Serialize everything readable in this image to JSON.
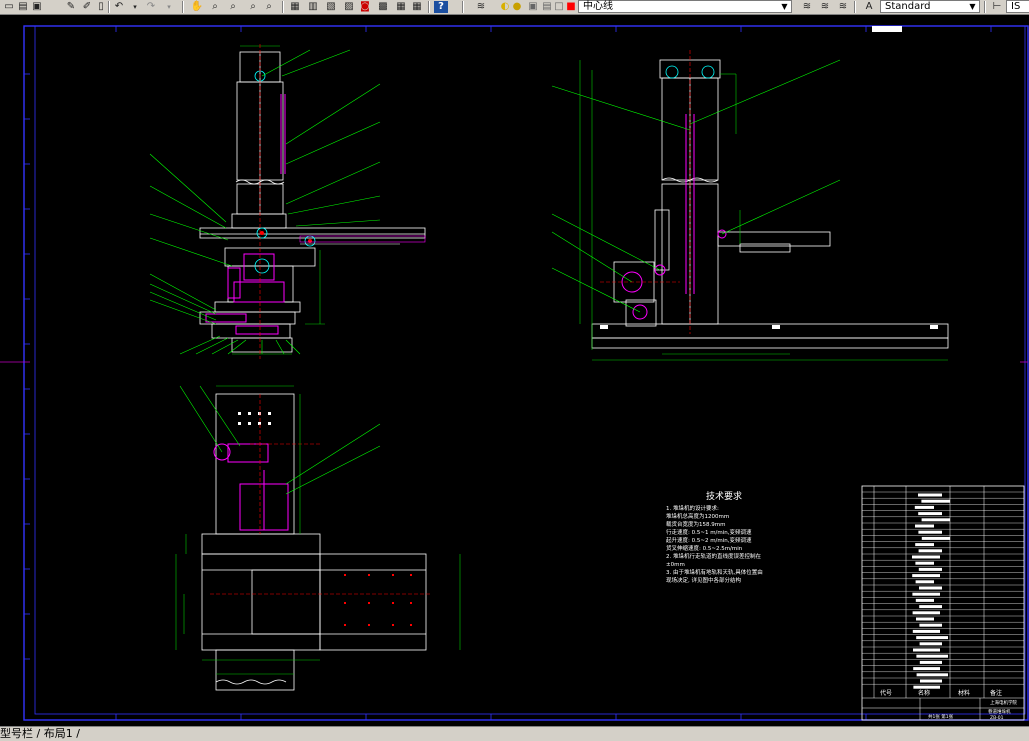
{
  "toolbar": {
    "layer_name": "中心线",
    "text_style": "Standard",
    "partial_right": "IS"
  },
  "layout_tabs": {
    "text": "型号栏 / 布局1 /"
  },
  "drawing": {
    "notes_title": "技术要求",
    "notes_lines": [
      "1. 堆垛机的设计要求:",
      "   堆垛机总高度为1200mm",
      "   载货台宽度为158.9mm",
      "   行走速度: 0.5~1 m/min,变频调速",
      "   起升速度: 0.5~2 m/min,变频调速",
      "   货叉伸缩速度: 0.5~2.5m/min",
      "2. 堆垛机行走轨道的直线度误差控制在",
      "   ±0mm",
      "3. 由于堆垛机有地轨和天轨,具体位置由",
      "   现场决定, 详见图中各部分结构"
    ],
    "title_block": {
      "col_code": "代号",
      "col_name": "名称",
      "col_material": "材料",
      "col_remark": "备注",
      "school": "上海电机学院",
      "drawing_name": "巷道堆垛机",
      "sheet": "共1张 第1张",
      "drawing_no": "ZB-01"
    }
  }
}
